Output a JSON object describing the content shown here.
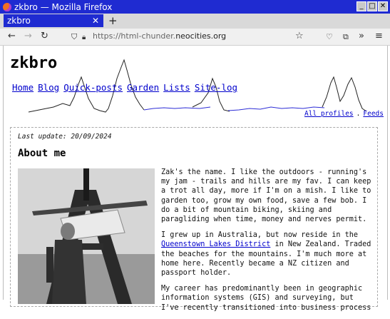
{
  "window": {
    "title": "zkbro — Mozilla Firefox"
  },
  "tab": {
    "label": "zkbro"
  },
  "address": {
    "prefix": "https://html-chunder.",
    "domain": "neocities.org"
  },
  "site": {
    "title": "zkbro",
    "menu": [
      "Home",
      "Blog",
      "Quick-posts",
      "Garden",
      "Lists",
      "Site-log"
    ],
    "all_profiles": "All profiles",
    "separator": ".",
    "feeds": "Feeds"
  },
  "content": {
    "last_update": "Last update: 20/09/2024",
    "heading": "About me",
    "p1": "Zak's the name. I like the outdoors - running's my jam - trails and hills are my fav. I can keep a trot all day, more if I'm on a mish. I like to garden too, grow my own food, save a few bob. I do a bit of mountain biking, skiing and paragliding when time, money and nerves permit.",
    "p2_before": "I grew up in Australia, but now reside in the ",
    "p2_link": "Queenstown Lakes District",
    "p2_after": " in New Zealand. Traded the beaches for the mountains. I'm much more at home here. Recently became a NZ citizen and passport holder.",
    "p3": "My career has predominantly been in geographic information systems (GIS) and surveying, but I've recently transitioned into business process"
  }
}
